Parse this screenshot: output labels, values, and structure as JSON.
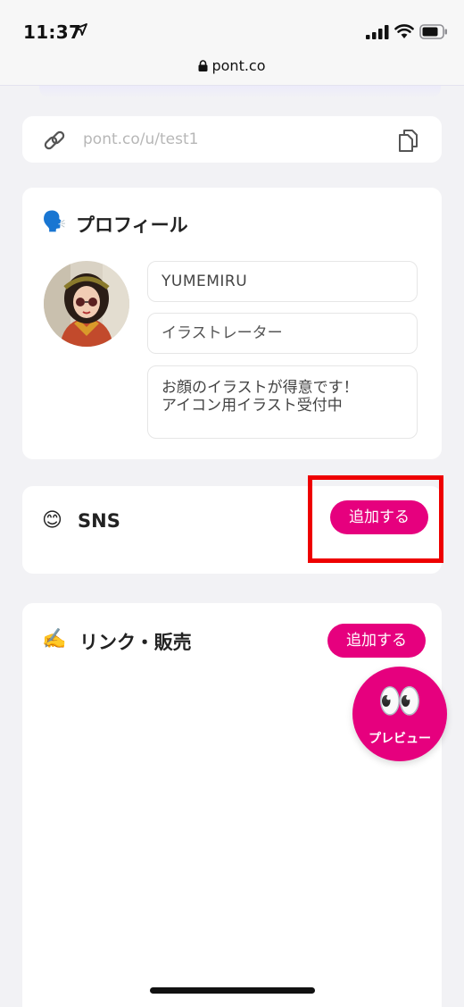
{
  "status_bar": {
    "time": "11:37"
  },
  "browser": {
    "domain": "pont.co"
  },
  "url_card": {
    "url_text": "pont.co/u/test1"
  },
  "profile": {
    "emoji": "🗣️",
    "title": "プロフィール",
    "name_value": "YUMEMIRU",
    "job_value": "イラストレーター",
    "bio_line_1": "お顔のイラストが得意です！",
    "bio_line_2": "アイコン用イラスト受付中"
  },
  "sns": {
    "emoji": "😊",
    "title": "SNS",
    "add_label": "追加する"
  },
  "links": {
    "emoji": "✍️",
    "title": "リンク・販売",
    "add_label": "追加する"
  },
  "preview": {
    "emoji": "👀",
    "label": "プレビュー"
  },
  "colors": {
    "accent": "#e6007e",
    "highlight": "#ee0000",
    "background": "#f2f2f5"
  }
}
